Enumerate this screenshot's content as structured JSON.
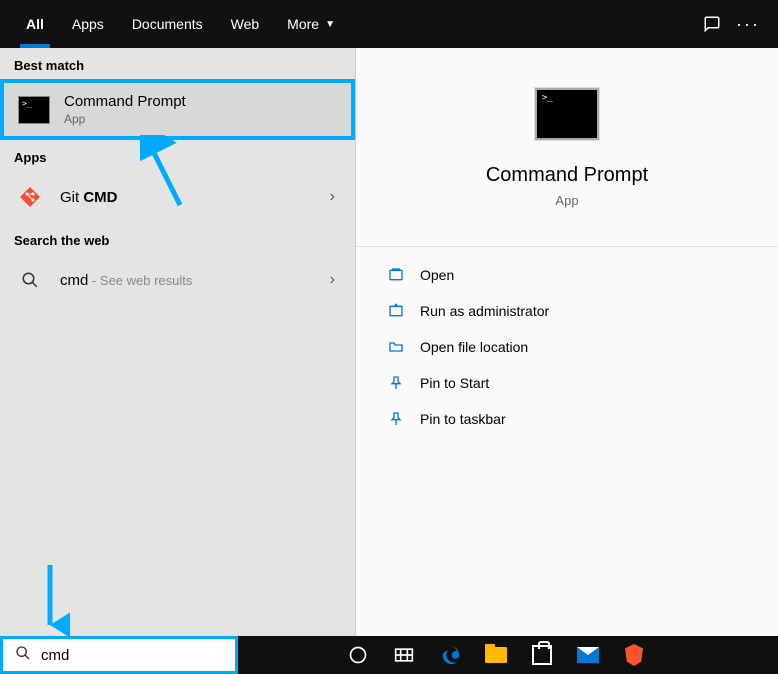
{
  "tabs": {
    "all": "All",
    "apps": "Apps",
    "documents": "Documents",
    "web": "Web",
    "more": "More"
  },
  "sections": {
    "best_match": "Best match",
    "apps": "Apps",
    "search_web": "Search the web"
  },
  "results": {
    "cmd_prompt": {
      "title": "Command Prompt",
      "sub": "App"
    },
    "git_cmd": {
      "prefix": "Git ",
      "bold": "CMD"
    },
    "web": {
      "query": "cmd",
      "suffix": " - See web results"
    }
  },
  "preview": {
    "title": "Command Prompt",
    "sub": "App"
  },
  "actions": {
    "open": "Open",
    "run_admin": "Run as administrator",
    "open_location": "Open file location",
    "pin_start": "Pin to Start",
    "pin_taskbar": "Pin to taskbar"
  },
  "search": {
    "value": "cmd"
  }
}
